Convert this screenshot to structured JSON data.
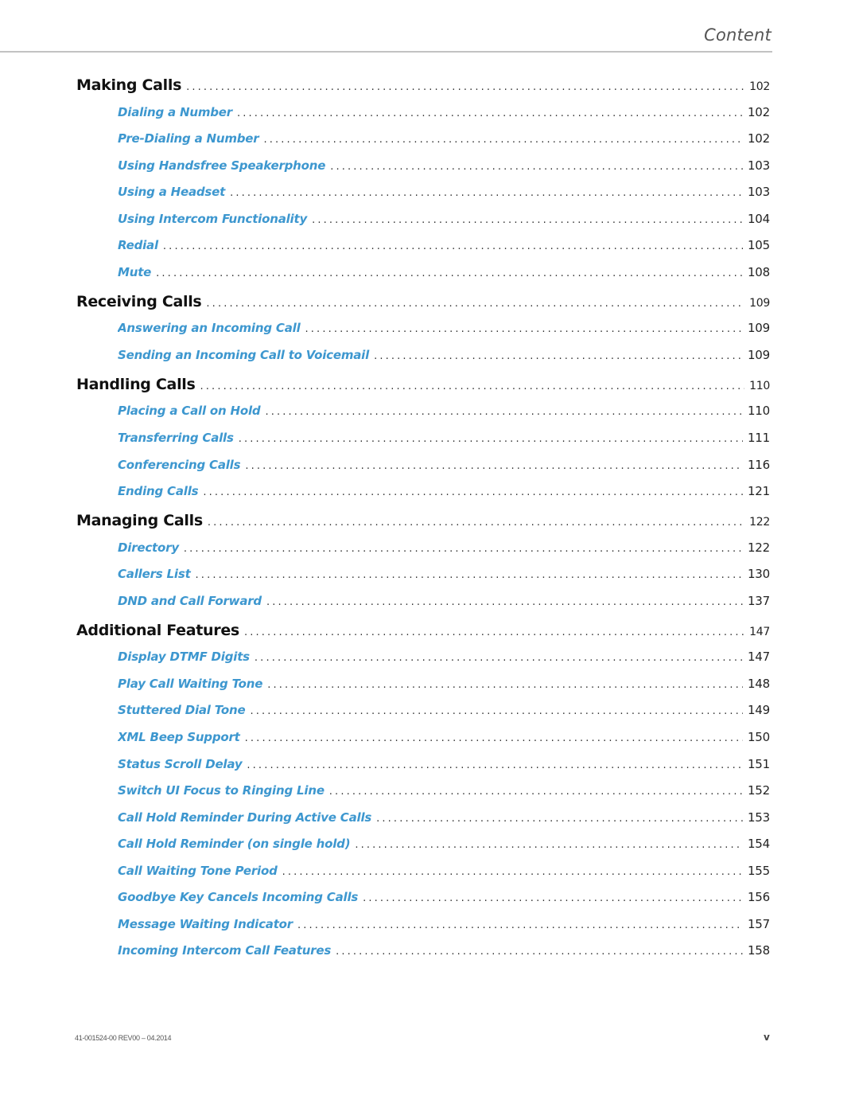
{
  "header": {
    "title": "Content"
  },
  "toc": [
    {
      "level": 1,
      "label": "Making Calls",
      "page": "102"
    },
    {
      "level": 2,
      "label": "Dialing a Number",
      "page": "102"
    },
    {
      "level": 2,
      "label": "Pre-Dialing a Number",
      "page": "102"
    },
    {
      "level": 2,
      "label": "Using Handsfree Speakerphone",
      "page": "103"
    },
    {
      "level": 2,
      "label": "Using a Headset",
      "page": "103"
    },
    {
      "level": 2,
      "label": "Using Intercom Functionality",
      "page": "104"
    },
    {
      "level": 2,
      "label": "Redial",
      "page": "105"
    },
    {
      "level": 2,
      "label": "Mute",
      "page": "108"
    },
    {
      "level": 1,
      "label": "Receiving Calls",
      "page": "109"
    },
    {
      "level": 2,
      "label": "Answering an Incoming Call",
      "page": "109"
    },
    {
      "level": 2,
      "label": "Sending an Incoming Call to Voicemail",
      "page": "109"
    },
    {
      "level": 1,
      "label": "Handling Calls",
      "page": "110"
    },
    {
      "level": 2,
      "label": "Placing a Call on Hold",
      "page": "110"
    },
    {
      "level": 2,
      "label": "Transferring Calls",
      "page": "111"
    },
    {
      "level": 2,
      "label": "Conferencing Calls",
      "page": "116"
    },
    {
      "level": 2,
      "label": "Ending Calls",
      "page": "121"
    },
    {
      "level": 1,
      "label": "Managing Calls",
      "page": "122"
    },
    {
      "level": 2,
      "label": "Directory",
      "page": "122"
    },
    {
      "level": 2,
      "label": "Callers List",
      "page": "130"
    },
    {
      "level": 2,
      "label": "DND and Call Forward",
      "page": "137"
    },
    {
      "level": 1,
      "label": "Additional Features",
      "page": "147"
    },
    {
      "level": 2,
      "label": "Display DTMF Digits",
      "page": "147"
    },
    {
      "level": 2,
      "label": "Play Call Waiting Tone",
      "page": "148"
    },
    {
      "level": 2,
      "label": "Stuttered Dial Tone",
      "page": "149"
    },
    {
      "level": 2,
      "label": "XML Beep Support",
      "page": "150"
    },
    {
      "level": 2,
      "label": "Status Scroll Delay",
      "page": "151"
    },
    {
      "level": 2,
      "label": "Switch UI Focus to Ringing Line",
      "page": "152"
    },
    {
      "level": 2,
      "label": "Call Hold Reminder During Active Calls",
      "page": "153"
    },
    {
      "level": 2,
      "label": "Call Hold Reminder (on single hold)",
      "page": "154"
    },
    {
      "level": 2,
      "label": "Call Waiting Tone Period",
      "page": "155"
    },
    {
      "level": 2,
      "label": "Goodbye Key Cancels Incoming Calls",
      "page": "156"
    },
    {
      "level": 2,
      "label": "Message Waiting Indicator",
      "page": "157"
    },
    {
      "level": 2,
      "label": "Incoming Intercom Call Features",
      "page": "158"
    }
  ],
  "footer": {
    "doc_id": "41-001524-00 REV00 – 04.2014",
    "page_number": "v"
  },
  "colors": {
    "heading": "#111111",
    "subentry_link": "#3d97cf",
    "rule": "#c2c2c2"
  }
}
